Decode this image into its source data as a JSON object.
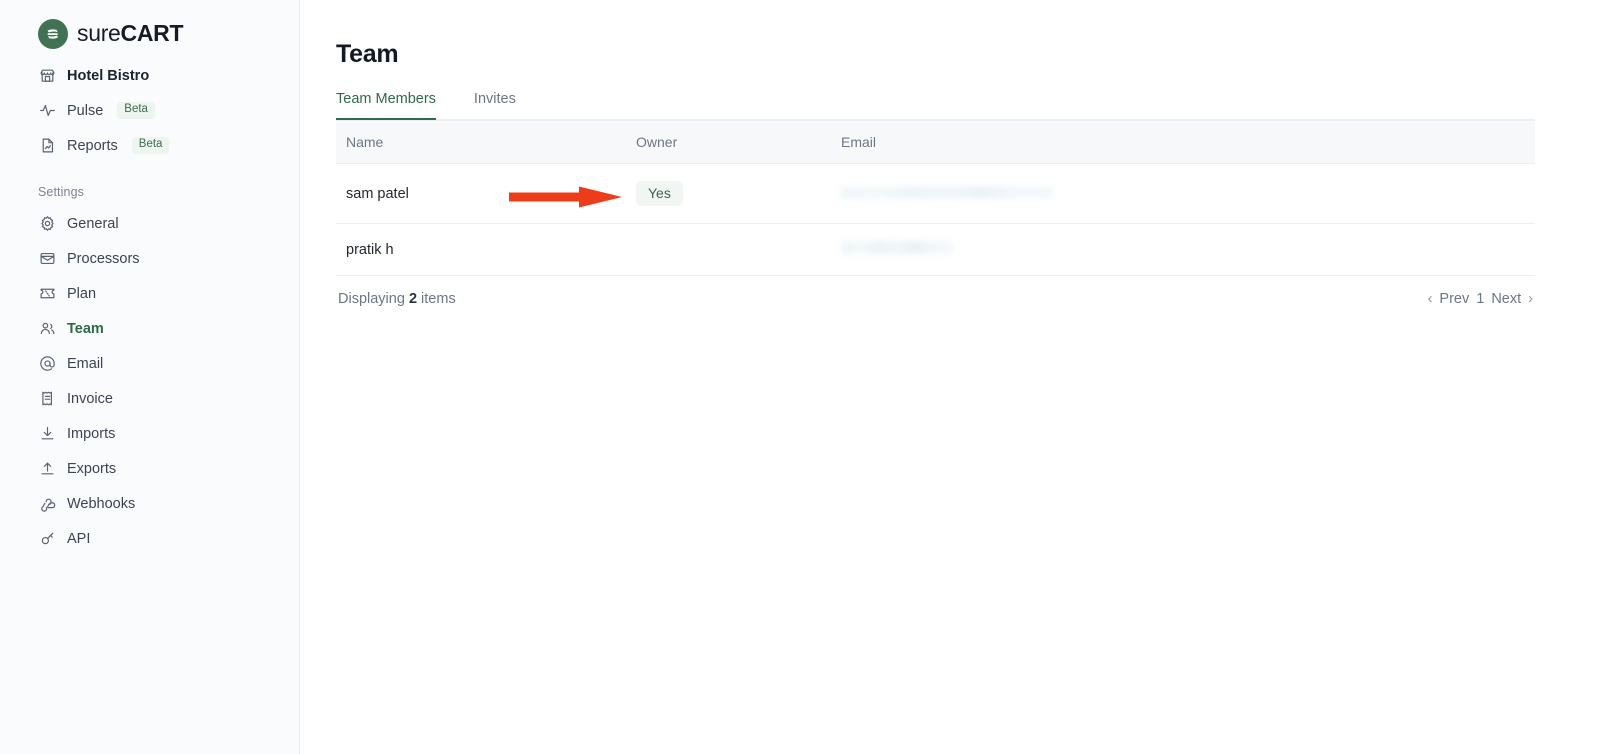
{
  "brand": {
    "logo_light": "sure",
    "logo_bold": "CART",
    "logo_icon": "surecart-s-logo-icon",
    "accent_green": "#2e6b49",
    "logo_circle_color": "#3f7354",
    "annotation_arrow_color": "#ee3b1a"
  },
  "sidebar": {
    "store": {
      "label": "Hotel Bistro",
      "icon": "store-icon"
    },
    "top_items": [
      {
        "label": "Pulse",
        "icon": "pulse-icon",
        "badge": "Beta"
      },
      {
        "label": "Reports",
        "icon": "report-document-icon",
        "badge": "Beta"
      }
    ],
    "section_title": "Settings",
    "settings_items": [
      {
        "label": "General",
        "icon": "gear-icon",
        "active": false
      },
      {
        "label": "Processors",
        "icon": "card-reader-icon",
        "active": false
      },
      {
        "label": "Plan",
        "icon": "ticket-icon",
        "active": false
      },
      {
        "label": "Team",
        "icon": "users-icon",
        "active": true
      },
      {
        "label": "Email",
        "icon": "at-sign-icon",
        "active": false
      },
      {
        "label": "Invoice",
        "icon": "invoice-icon",
        "active": false
      },
      {
        "label": "Imports",
        "icon": "download-icon",
        "active": false
      },
      {
        "label": "Exports",
        "icon": "upload-icon",
        "active": false
      },
      {
        "label": "Webhooks",
        "icon": "webhook-icon",
        "active": false
      },
      {
        "label": "API",
        "icon": "key-icon",
        "active": false
      }
    ]
  },
  "main": {
    "page_title": "Team",
    "tabs": [
      {
        "label": "Team Members",
        "active": true
      },
      {
        "label": "Invites",
        "active": false
      }
    ],
    "table": {
      "columns": [
        "Name",
        "Owner",
        "Email"
      ],
      "rows": [
        {
          "name": "sam patel",
          "owner": "Yes",
          "email": "",
          "email_redacted": true
        },
        {
          "name": "pratik h",
          "owner": "",
          "email": "",
          "email_redacted": true
        }
      ]
    },
    "footer": {
      "displaying_prefix": "Displaying",
      "count": "2",
      "displaying_suffix": "items",
      "pagination": {
        "prev_chevron": "‹",
        "prev": "Prev",
        "page": "1",
        "next": "Next",
        "next_chevron": "›"
      }
    }
  },
  "annotation": {
    "arrow": "red-right-arrow-annotation",
    "points_to": "Yes"
  }
}
